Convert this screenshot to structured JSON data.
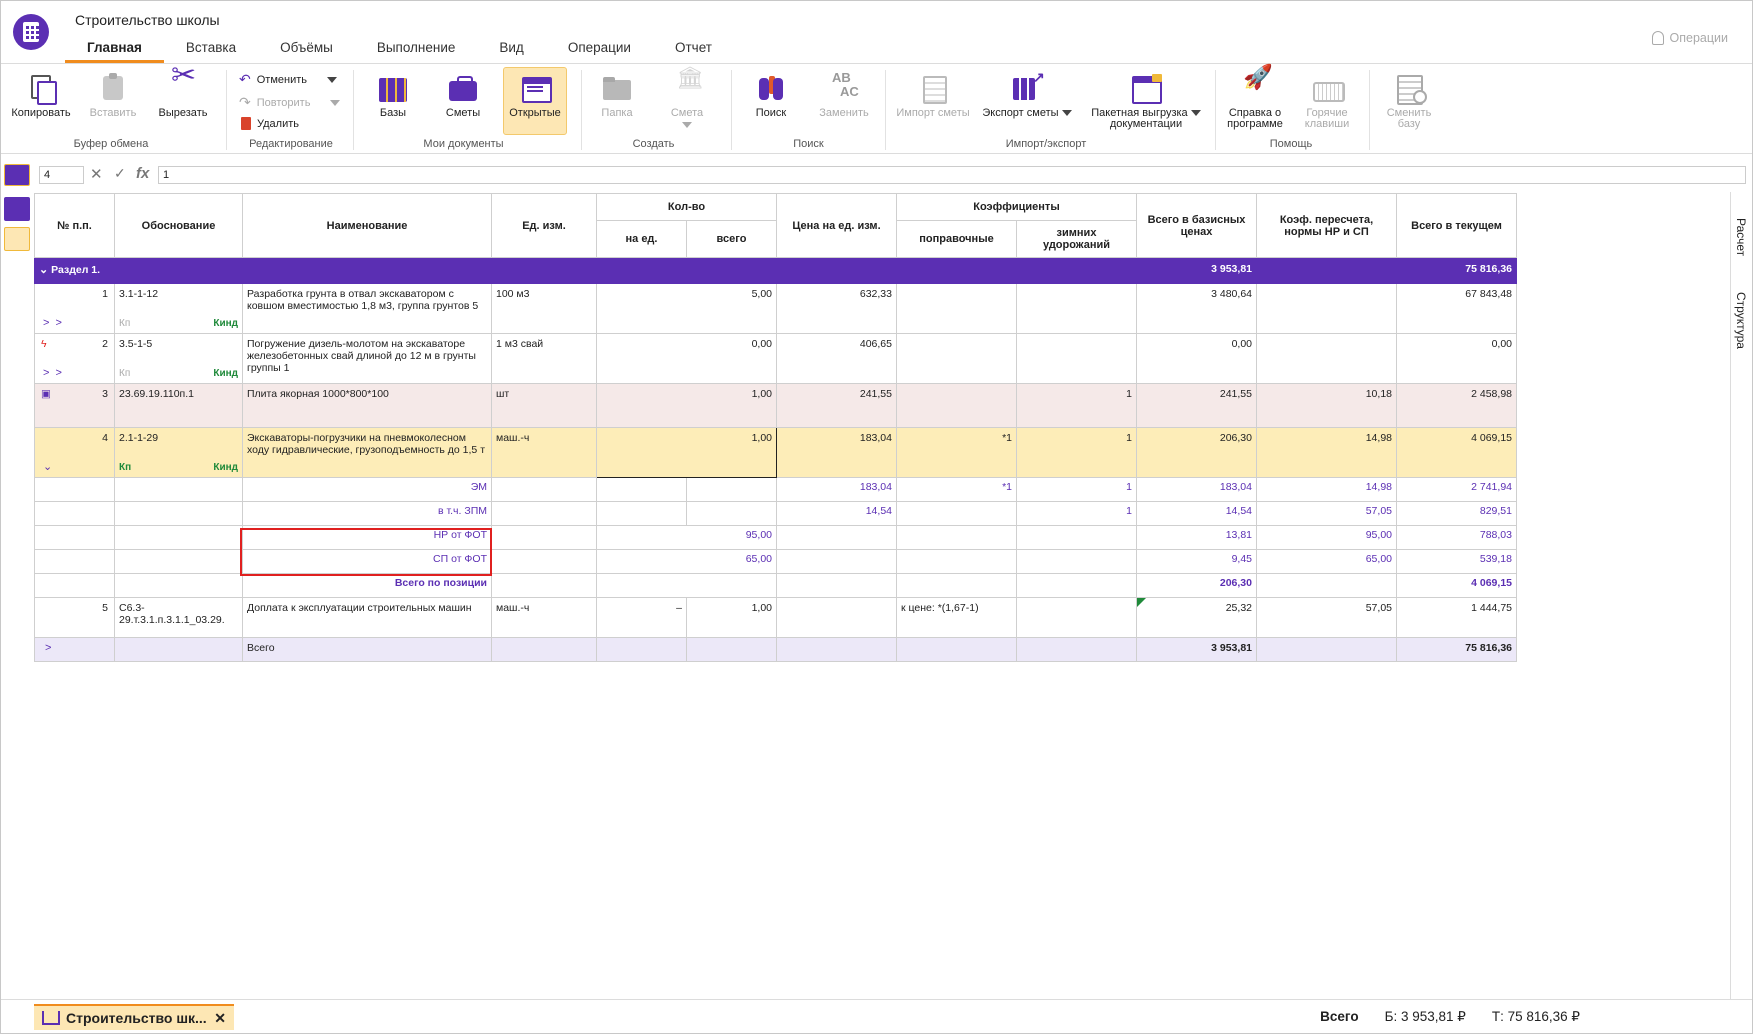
{
  "app": {
    "title": "Строительство школы"
  },
  "tabs": [
    "Главная",
    "Вставка",
    "Объёмы",
    "Выполнение",
    "Вид",
    "Операции",
    "Отчет"
  ],
  "operations_label": "Операции",
  "ribbon": {
    "copy": "Копировать",
    "paste": "Вставить",
    "cut": "Вырезать",
    "clipboard_group": "Буфер обмена",
    "undo": "Отменить",
    "redo": "Повторить",
    "delete": "Удалить",
    "edit_group": "Редактирование",
    "bases": "Базы",
    "smety": "Сметы",
    "opened": "Открытые",
    "mydocs_group": "Мои документы",
    "folder": "Папка",
    "smeta": "Смета",
    "create_group": "Создать",
    "search": "Поиск",
    "replace": "Заменить",
    "search_group": "Поиск",
    "import": "Импорт сметы",
    "export": "Экспорт сметы",
    "batch_line1": "Пакетная выгрузка",
    "batch_line2": "документации",
    "ie_group": "Импорт/экспорт",
    "help_line1": "Справка о",
    "help_line2": "программе",
    "keys_line1": "Горячие",
    "keys_line2": "клавиши",
    "help_group": "Помощь",
    "changebase_line1": "Сменить",
    "changebase_line2": "базу"
  },
  "formula": {
    "cell": "4",
    "value": "1"
  },
  "side_tabs": [
    "Расчет",
    "Структура"
  ],
  "headers": {
    "num": "№ п.п.",
    "basis": "Обоснование",
    "name": "Наименование",
    "unit": "Ед. изм.",
    "qty": "Кол-во",
    "qty_per": "на ед.",
    "qty_total": "всего",
    "price": "Цена на ед. изм.",
    "coef": "Коэффициенты",
    "coef_corr": "поправочные",
    "coef_winter_1": "зимних",
    "coef_winter_2": "удорожаний",
    "total_base_1": "Всего в базисных",
    "total_base_2": "ценах",
    "recalc_1": "Коэф. пересчета,",
    "recalc_2": "нормы НР и СП",
    "total_cur": "Всего в текущем"
  },
  "section": {
    "label": "Раздел 1.",
    "total_base": "3 953,81",
    "total_cur": "75 816,36"
  },
  "rows": [
    {
      "num": "1",
      "basis": "3.1-1-12",
      "name": "Разработка грунта в отвал экскаватором с ковшом вместимостью 1,8 м3, группа грунтов 5",
      "unit": "100 м3",
      "qty_total": "5,00",
      "price": "632,33",
      "total_base": "3 480,64",
      "total_cur": "67 843,48",
      "kp": "Кп",
      "kind": "Кинд"
    },
    {
      "num": "2",
      "basis": "3.5-1-5",
      "name": "Погружение дизель-молотом на экскаваторе железобетонных свай длиной до 12 м в грунты группы 1",
      "unit": "1 м3 свай",
      "qty_total": "0,00",
      "price": "406,65",
      "total_base": "0,00",
      "total_cur": "0,00",
      "kp": "Кп",
      "kind": "Кинд"
    },
    {
      "num": "3",
      "basis": "23.69.19.110п.1",
      "name": "Плита якорная 1000*800*100",
      "unit": "шт",
      "qty_total": "1,00",
      "price": "241,55",
      "winter": "1",
      "total_base": "241,55",
      "recalc": "10,18",
      "total_cur": "2 458,98"
    },
    {
      "num": "4",
      "basis": "2.1-1-29",
      "name": "Экскаваторы-погрузчики на пневмоколесном ходу гидравлические, грузоподъемность до 1,5 т",
      "unit": "маш.-ч",
      "qty_total": "1,00",
      "price": "183,04",
      "corr": "*1",
      "winter": "1",
      "total_base": "206,30",
      "recalc": "14,98",
      "total_cur": "4 069,15",
      "kp": "Кп",
      "kind": "Кинд"
    }
  ],
  "subrows": [
    {
      "name": "ЭМ",
      "price": "183,04",
      "corr": "*1",
      "winter": "1",
      "total_base": "183,04",
      "recalc": "14,98",
      "total_cur": "2 741,94"
    },
    {
      "name": "в т.ч. ЗПМ",
      "price": "14,54",
      "winter": "1",
      "total_base": "14,54",
      "recalc": "57,05",
      "total_cur": "829,51"
    },
    {
      "name": "НР от ФОТ",
      "qty_total": "95,00",
      "total_base": "13,81",
      "recalc": "95,00",
      "total_cur": "788,03"
    },
    {
      "name": "СП от ФОТ",
      "qty_total": "65,00",
      "total_base": "9,45",
      "recalc": "65,00",
      "total_cur": "539,18"
    },
    {
      "name": "Всего по позиции",
      "total_base": "206,30",
      "total_cur": "4 069,15"
    }
  ],
  "row5": {
    "num": "5",
    "basis": "С6.3-29.т.3.1.п.3.1.1_03.29.",
    "name": "Доплата к эксплуатации строительных машин",
    "unit": "маш.-ч",
    "qty_per": "–",
    "qty_total": "1,00",
    "corr": "к цене: *(1,67-1)",
    "total_base": "25,32",
    "recalc": "57,05",
    "total_cur": "1 444,75"
  },
  "total_row": {
    "label": "Всего",
    "total_base": "3 953,81",
    "total_cur": "75 816,36"
  },
  "bottom": {
    "tab_label": "Строительство шк...",
    "total_label": "Всего",
    "base_total": "Б: 3 953,81 ₽",
    "cur_total": "Т: 75 816,36 ₽"
  },
  "colors": {
    "accent": "#5b2fb3",
    "highlight": "#fdedb8",
    "tab_accent": "#f08c1e",
    "red_frame": "#e0201f"
  }
}
